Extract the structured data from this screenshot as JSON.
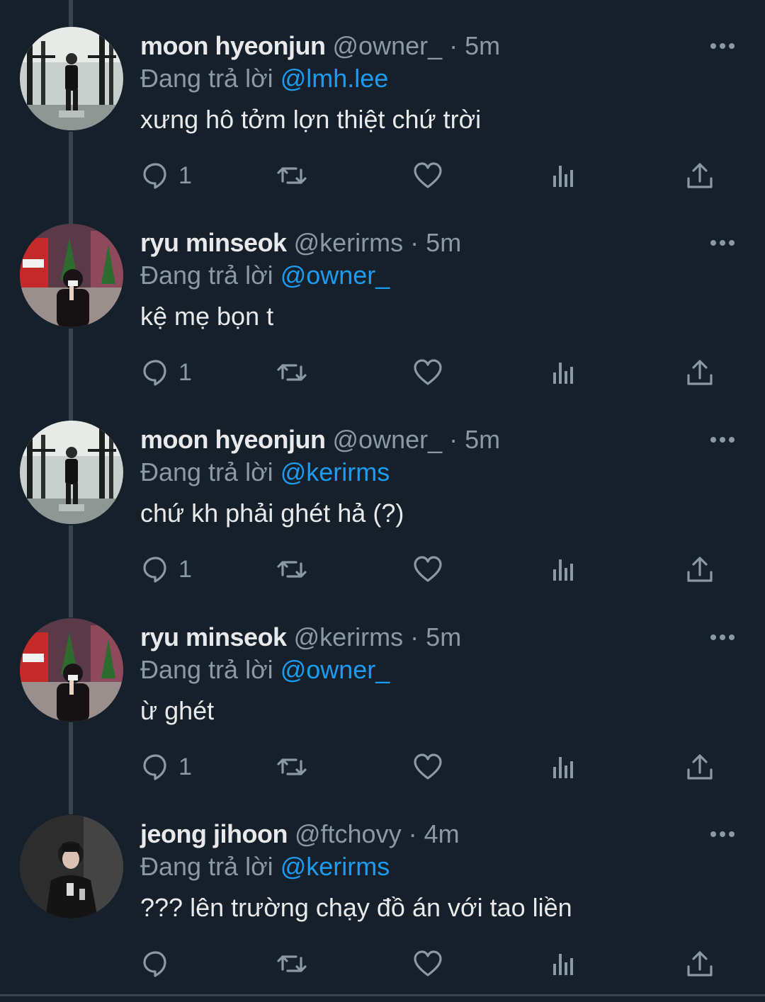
{
  "colors": {
    "background": "#15202b",
    "text_primary": "#e7e9ea",
    "text_secondary": "#8b98a5",
    "link": "#1d9bf0",
    "thread_line": "#38444d"
  },
  "tweets": [
    {
      "name": "moon hyeonjun",
      "handle": "@owner_",
      "separator": "·",
      "time": "5m",
      "replying_prefix": "Đang trả lời",
      "replying_to": "@lmh.lee",
      "text": "xưng hô tởm lợn thiệt chứ trời",
      "reply_count": "1",
      "avatar": "gym-avatar"
    },
    {
      "name": "ryu minseok",
      "handle": "@kerirms",
      "separator": "·",
      "time": "5m",
      "replying_prefix": "Đang trả lời",
      "replying_to": "@owner_",
      "text": "kệ mẹ bọn t",
      "reply_count": "1",
      "avatar": "city-avatar"
    },
    {
      "name": "moon hyeonjun",
      "handle": "@owner_",
      "separator": "·",
      "time": "5m",
      "replying_prefix": "Đang trả lời",
      "replying_to": "@kerirms",
      "text": "chứ kh phải ghét hả (?)",
      "reply_count": "1",
      "avatar": "gym-avatar"
    },
    {
      "name": "ryu minseok",
      "handle": "@kerirms",
      "separator": "·",
      "time": "5m",
      "replying_prefix": "Đang trả lời",
      "replying_to": "@owner_",
      "text": "ừ ghét",
      "reply_count": "1",
      "avatar": "city-avatar"
    },
    {
      "name": "jeong jihoon",
      "handle": "@ftchovy",
      "separator": "·",
      "time": "4m",
      "replying_prefix": "Đang trả lời",
      "replying_to": "@kerirms",
      "text": "??? lên trường chạy đồ án với tao liền",
      "reply_count": "",
      "avatar": "dark-avatar"
    }
  ],
  "icons": {
    "reply": "reply-icon",
    "retweet": "retweet-icon",
    "like": "like-icon",
    "views": "views-icon",
    "share": "share-icon",
    "more": "more-options-icon"
  }
}
